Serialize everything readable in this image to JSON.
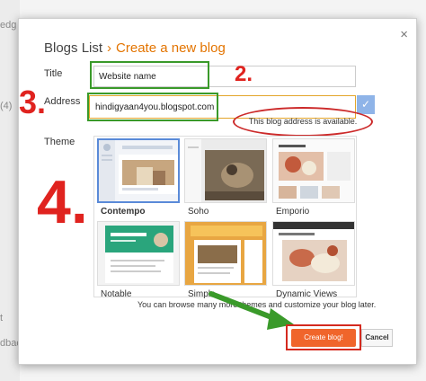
{
  "background": {
    "fragments": [
      "edg",
      "(4)",
      "t",
      "dbac"
    ]
  },
  "dialog": {
    "close_label": "×",
    "breadcrumb": {
      "parent": "Blogs List",
      "separator": "›",
      "current": "Create a new blog"
    },
    "title": {
      "label": "Title",
      "value": "Website name"
    },
    "address": {
      "label": "Address",
      "value": "hindigyaan4you.blogspot.com",
      "check_icon": "✓",
      "availability": "This blog address is available."
    },
    "theme": {
      "label": "Theme",
      "items": [
        {
          "name": "Contempo",
          "selected": true
        },
        {
          "name": "Soho",
          "selected": false
        },
        {
          "name": "Emporio",
          "selected": false
        },
        {
          "name": "Notable",
          "selected": false
        },
        {
          "name": "Simple",
          "selected": false
        },
        {
          "name": "Dynamic Views",
          "selected": false
        }
      ]
    },
    "browse_text": "You can browse many more themes and customize your blog later.",
    "create_label": "Create blog!",
    "cancel_label": "Cancel"
  },
  "annotations": {
    "step2": "2.",
    "step3": "3.",
    "step4": "4."
  },
  "colors": {
    "accent": "#e37400",
    "annotation_red": "#e0231f",
    "annotation_green": "#3a9a2a",
    "create_button": "#f0652b",
    "check_button": "#8fb4e8"
  }
}
